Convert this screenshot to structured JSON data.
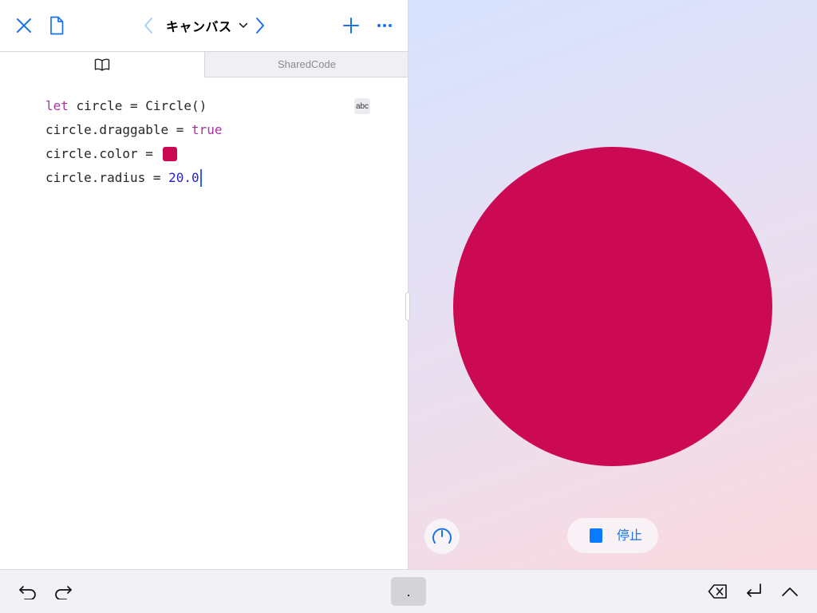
{
  "colors": {
    "accent": "#1a73e8",
    "circle": "#cc0a53",
    "stop": "#0a7aff"
  },
  "navbar": {
    "title": "キャンバス",
    "icons": {
      "close": "close-icon",
      "document": "document-icon",
      "back": "chevron-left-icon",
      "title_menu": "chevron-down-icon",
      "forward": "chevron-right-icon",
      "add": "plus-icon",
      "more": "ellipsis-icon"
    }
  },
  "tabs": {
    "main_icon": "book-icon",
    "shared_label": "SharedCode"
  },
  "code": {
    "line1": {
      "keyword": "let",
      "rest": " circle = Circle()"
    },
    "line2": {
      "prefix": "circle.draggable = ",
      "keyword": "true"
    },
    "line3": {
      "prefix": "circle.color = ",
      "swatch_color": "#cc0a53"
    },
    "line4": {
      "prefix": "circle.radius = ",
      "number": "20.0"
    },
    "badge": "abc"
  },
  "live_view": {
    "circle_color": "#cc0a53",
    "stop_label": "停止",
    "speed_icon": "speedometer-icon"
  },
  "shortcut_bar": {
    "undo_icon": "undo-icon",
    "redo_icon": "redo-icon",
    "key_label": ".",
    "delete_icon": "delete-backward-icon",
    "return_icon": "return-icon",
    "expand_icon": "chevron-up-icon"
  }
}
